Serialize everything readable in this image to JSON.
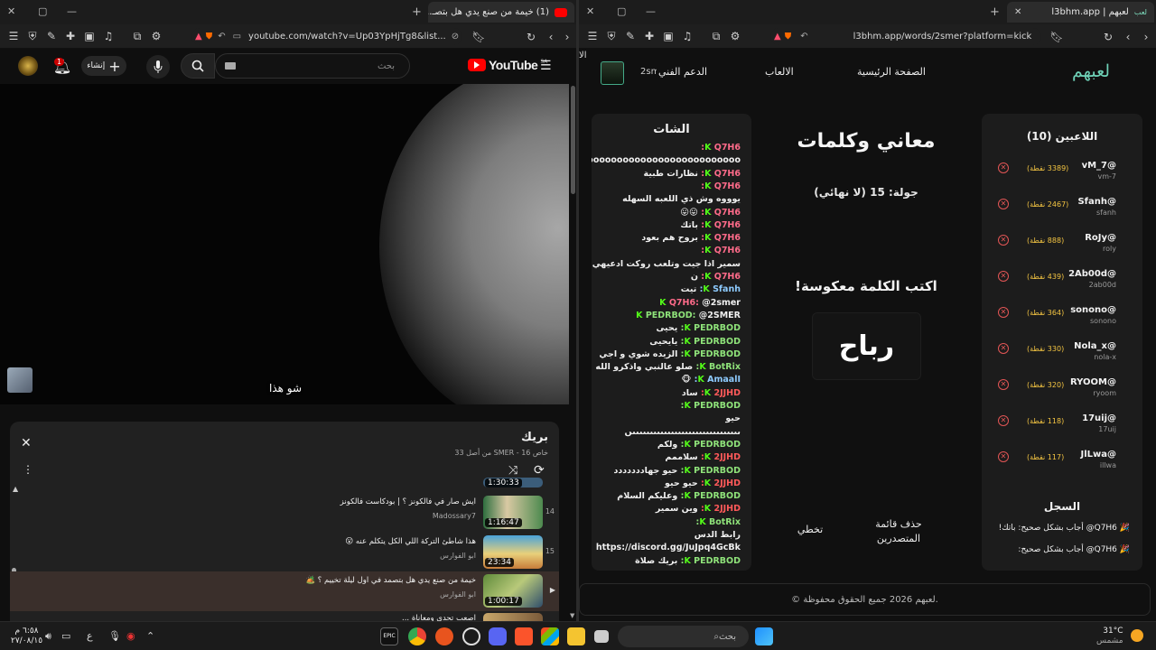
{
  "left_window": {
    "tab_title": "(1) خيمة من صنع يدي هل بتصـ...",
    "url": "youtube.com/watch?v=Up03YpHjTg8&list...",
    "notif_count": "1",
    "create_label": "إنشاء",
    "search_placeholder": "بحث",
    "logo": "YouTube",
    "logo_region": "SA",
    "caption": "شو هذا",
    "playlist": {
      "title": "بريك",
      "subtitle": "خاص SMER - 16 من أصل 33",
      "items": [
        {
          "index": "",
          "title": "",
          "channel": "",
          "duration": "1:30:33"
        },
        {
          "index": "14",
          "title": "ايش صار في فالكونز ؟ | بودكاست فالكونز",
          "channel": "Madossary7",
          "duration": "1:16:47"
        },
        {
          "index": "15",
          "title": "هذا شاطئ التركة اللي الكل يتكلم عنه 😮",
          "channel": "ابو الفوارس",
          "duration": "23:34"
        },
        {
          "index": "",
          "title": "خيمة من صنع يدي هل بتصمد في اول ليلة تخييم ؟ 🏕️",
          "channel": "ابو الفوارس",
          "duration": "1:00:17"
        },
        {
          "index": "",
          "title": "اصعب تحدي ومعاناة ...",
          "channel": "",
          "duration": ""
        }
      ]
    }
  },
  "right_window": {
    "tab_title": "لعبهم | l3bhm.app",
    "url": "l3bhm.app/words/2smer?platform=kick",
    "nav": {
      "logo": "لعبهم",
      "home": "الصفحة الرئيسية",
      "games": "الالعاب",
      "support": "الدعم الفني",
      "user": "2smer",
      "cut": "الا"
    },
    "players_title": "اللاعبين (10)",
    "players": [
      {
        "name": "vM_7@",
        "user": "vm-7",
        "points": "(3389 نقطة)"
      },
      {
        "name": "Sfanh@",
        "user": "sfanh",
        "points": "(2467 نقطة)"
      },
      {
        "name": "RoJy@",
        "user": "roly",
        "points": "(888 نقطة)"
      },
      {
        "name": "2Ab00d@",
        "user": "2ab00d",
        "points": "(439 نقطة)"
      },
      {
        "name": "sonono@",
        "user": "sonono",
        "points": "(364 نقطة)"
      },
      {
        "name": "Nola_x@",
        "user": "nola-x",
        "points": "(330 نقطة)"
      },
      {
        "name": "RYOOM@",
        "user": "ryoom",
        "points": "(320 نقطة)"
      },
      {
        "name": "17uij@",
        "user": "17uij",
        "points": "(118 نقطة)"
      },
      {
        "name": "JlLwa@",
        "user": "illwa",
        "points": "(117 نقطة)"
      }
    ],
    "log_title": "السجل",
    "log": [
      "🎉 Q7H6@ أجاب بشكل صحيح: باتك!",
      "🎉 Q7H6@ أجاب بشكل صحيح:"
    ],
    "game_title": "معاني وكلمات",
    "round": "جولة: 15 (لا نهائي)",
    "instruction": "اكتب الكلمة معكوسة!",
    "word": "رباح",
    "clear_board": "حذف قائمة المتصدرين",
    "skip": "تخطي",
    "chat_title": "الشات",
    "chat": [
      {
        "user": "Q7H6:",
        "text": "",
        "color": "#ff6b8a"
      },
      {
        "user": "",
        "text": "9ooooooooooooooooooooooooooooooooo",
        "color": ""
      },
      {
        "user": "Q7H6:",
        "text": "نظارات طبية",
        "color": "#ff6b8a"
      },
      {
        "user": "Q7H6:",
        "text": "",
        "color": "#ff6b8a"
      },
      {
        "user": "",
        "text": "يوووه وش ذي اللعبه السهله",
        "color": ""
      },
      {
        "user": "Q7H6:",
        "text": "😛😛",
        "color": "#ff6b8a"
      },
      {
        "user": "Q7H6:",
        "text": "باتك",
        "color": "#ff6b8a"
      },
      {
        "user": "Q7H6:",
        "text": "بروح هم بعود",
        "color": "#ff6b8a"
      },
      {
        "user": "Q7H6:",
        "text": "",
        "color": "#ff6b8a"
      },
      {
        "user": "",
        "text": "سمير اذا جيت وتلعب روكت ادعيهي",
        "color": ""
      },
      {
        "user": "Q7H6:",
        "text": "ن",
        "color": "#ff6b8a"
      },
      {
        "user": "Sfanh:",
        "text": "تيت",
        "color": "#8ecbff"
      },
      {
        "user": "Q7H6:",
        "text": "@2smer",
        "color": "#ff6b8a"
      },
      {
        "user": "PEDRBOD:",
        "text": "@2SMER",
        "color": "#8fe37a"
      },
      {
        "user": "PEDRBOD:",
        "text": "يحيى",
        "color": "#8fe37a"
      },
      {
        "user": "PEDRBOD:",
        "text": "يايحيى",
        "color": "#8fe37a"
      },
      {
        "user": "PEDRBOD:",
        "text": "الزيده شوي و اجي",
        "color": "#8fe37a"
      },
      {
        "user": "BotRix:",
        "text": "صلو عالنبي واذكرو الله",
        "color": "#8fe37a"
      },
      {
        "user": "AmaalI:",
        "text": "🐵",
        "color": "#8ecbff"
      },
      {
        "user": "2JJHD:",
        "text": "ساد",
        "color": "#ff5a5a"
      },
      {
        "user": "PEDRBOD:",
        "text": "",
        "color": "#8fe37a"
      },
      {
        "user": "",
        "text": "حيو",
        "color": ""
      },
      {
        "user": "",
        "text": "ںںںںںںںںںںںںںںںںںںںںںںںںںںںںںںںں",
        "color": ""
      },
      {
        "user": "PEDRBOD:",
        "text": "ولكم",
        "color": "#8fe37a"
      },
      {
        "user": "2JJHD:",
        "text": "سلاممم",
        "color": "#ff5a5a"
      },
      {
        "user": "PEDRBOD:",
        "text": "حيو جهاددددددد",
        "color": "#8fe37a"
      },
      {
        "user": "2JJHD:",
        "text": "حيو حيو",
        "color": "#ff5a5a"
      },
      {
        "user": "PEDRBOD:",
        "text": "وعليكم السلام",
        "color": "#8fe37a"
      },
      {
        "user": "2JJHD:",
        "text": "وين سمير",
        "color": "#ff5a5a"
      },
      {
        "user": "BotRix:",
        "text": "",
        "color": "#8fe37a"
      },
      {
        "user": "",
        "text": "رابط الدس",
        "color": ""
      },
      {
        "user": "",
        "text": "https://discord.gg/JuJpq4GcBk",
        "color": ""
      },
      {
        "user": "PEDRBOD:",
        "text": "بريك صلاة",
        "color": "#8fe37a"
      }
    ],
    "footer": "© لعبهم 2026 جميع الحقوق محفوظة."
  },
  "taskbar": {
    "time": "٦:٥٨ م",
    "date": "٢٧/٠٨/١٥",
    "lang": "ع",
    "search": "بحث",
    "weather_temp": "31°C",
    "weather_desc": "مشمس"
  }
}
